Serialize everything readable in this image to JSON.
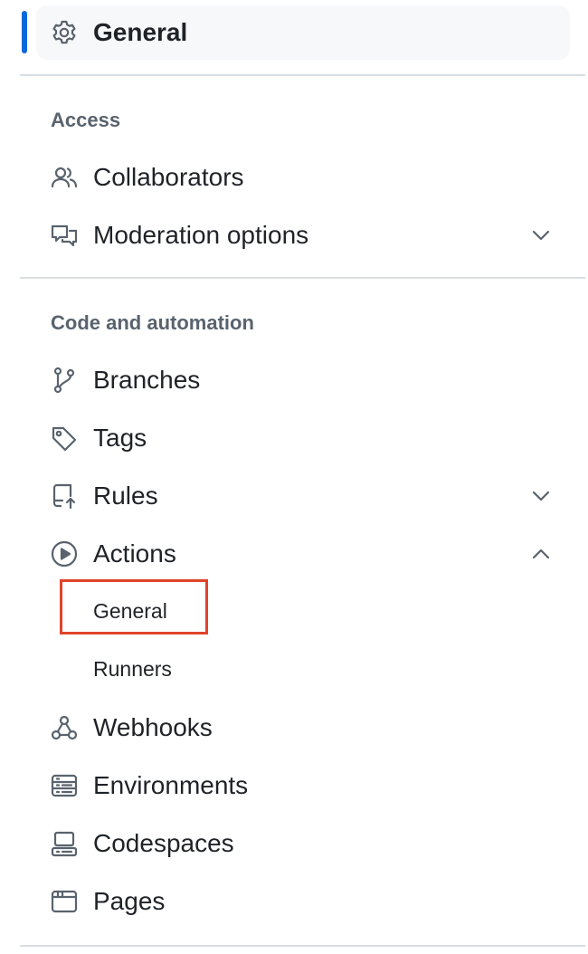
{
  "top": {
    "general_label": "General"
  },
  "access": {
    "title": "Access",
    "items": [
      {
        "label": "Collaborators"
      },
      {
        "label": "Moderation options"
      }
    ]
  },
  "code_automation": {
    "title": "Code and automation",
    "items": [
      {
        "label": "Branches"
      },
      {
        "label": "Tags"
      },
      {
        "label": "Rules"
      },
      {
        "label": "Actions"
      }
    ],
    "actions_sub": [
      {
        "label": "General"
      },
      {
        "label": "Runners"
      }
    ],
    "more_items": [
      {
        "label": "Webhooks"
      },
      {
        "label": "Environments"
      },
      {
        "label": "Codespaces"
      },
      {
        "label": "Pages"
      }
    ]
  },
  "colors": {
    "accent": "#0969da",
    "highlight": "#e0442b",
    "muted": "#59636e"
  }
}
